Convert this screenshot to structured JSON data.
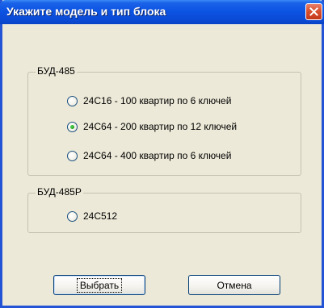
{
  "window": {
    "title": "Укажите модель и тип блока",
    "close_icon": "close-icon"
  },
  "groups": [
    {
      "legend": "БУД-485",
      "options": [
        {
          "label": "24C16 - 100 квартир по 6 ключей",
          "checked": false
        },
        {
          "label": "24C64 - 200 квартир по 12 ключей",
          "checked": true
        },
        {
          "label": "24C64 - 400 квартир по 6 ключей",
          "checked": false
        }
      ]
    },
    {
      "legend": "БУД-485Р",
      "options": [
        {
          "label": "24C512",
          "checked": false
        }
      ]
    }
  ],
  "buttons": {
    "select_label": "Выбрать",
    "cancel_label": "Отмена"
  },
  "colors": {
    "titlebar": "#0a49d3",
    "dialog_bg": "#ece9d8",
    "close_button": "#d9512f",
    "radio_checked": "#21a121"
  }
}
